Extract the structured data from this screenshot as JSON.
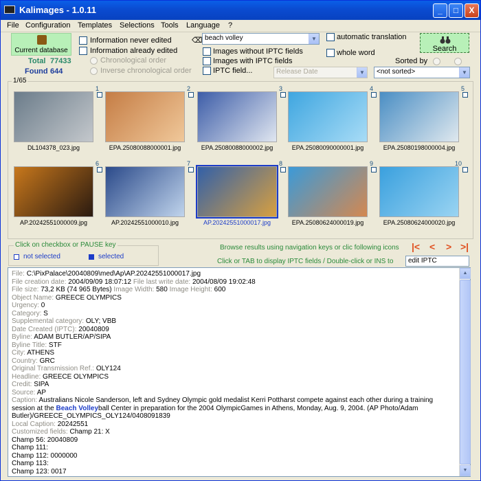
{
  "window": {
    "title": "Kalimages - 1.0.11",
    "minimize": "_",
    "maximize": "□",
    "close": "X"
  },
  "menu": [
    "File",
    "Configuration",
    "Templates",
    "Selections",
    "Tools",
    "Language",
    "?"
  ],
  "db": {
    "label": "Current database",
    "total_label": "Total",
    "total": "77433",
    "found_label": "Found",
    "found": "644"
  },
  "filters": {
    "never_edited": "Information never edited",
    "already_edited": "Information already edited",
    "chron": "Chronological order",
    "inv_chron": "Inverse chronological order",
    "query": "beach volley",
    "without_iptc": "Images without IPTC fields",
    "with_iptc": "Images with IPTC fields",
    "iptc_field": "IPTC field...",
    "release_date": "Release Date",
    "auto_translation": "automatic translation",
    "whole_word": "whole word",
    "sorted_by": "Sorted by",
    "not_sorted": "<not sorted>",
    "search": "Search"
  },
  "results": {
    "count": "1/65",
    "items": [
      {
        "num": "1",
        "file": "DL104378_023.jpg",
        "selected": false,
        "c1": "#6b7c8a",
        "c2": "#c4c8cc"
      },
      {
        "num": "2",
        "file": "EPA.25080088000001.jpg",
        "selected": false,
        "c1": "#c57d45",
        "c2": "#f0c89a"
      },
      {
        "num": "3",
        "file": "EPA.25080088000002.jpg",
        "selected": false,
        "c1": "#3d5da8",
        "c2": "#e0e6f0"
      },
      {
        "num": "4",
        "file": "EPA.25080090000001.jpg",
        "selected": false,
        "c1": "#3fa6e0",
        "c2": "#a8dcf6"
      },
      {
        "num": "5",
        "file": "EPA.25080198000004.jpg",
        "selected": false,
        "c1": "#4a8ec4",
        "c2": "#dfe8ee"
      },
      {
        "num": "6",
        "file": "AP.20242551000009.jpg",
        "selected": false,
        "c1": "#c8781c",
        "c2": "#2a1a10"
      },
      {
        "num": "7",
        "file": "AP.20242551000010.jpg",
        "selected": false,
        "c1": "#2b4a8a",
        "c2": "#c0d4ec"
      },
      {
        "num": "8",
        "file": "AP.20242551000017.jpg",
        "selected": true,
        "c1": "#3260a8",
        "c2": "#d8a040"
      },
      {
        "num": "9",
        "file": "EPA.25080624000019.jpg",
        "selected": false,
        "c1": "#3b9ad8",
        "c2": "#d48850"
      },
      {
        "num": "10",
        "file": "EPA.25080624000020.jpg",
        "selected": false,
        "c1": "#3aa0de",
        "c2": "#9ad4f2"
      }
    ]
  },
  "legend": {
    "title": "Click on checkbox or PAUSE key",
    "not_selected": "not selected",
    "selected": "selected"
  },
  "nav": {
    "browse": "Browse results using navigation keys or clic following icons",
    "display": "Click or TAB to display IPTC fields / Double-click or INS to",
    "edit": "edit IPTC",
    "first": "|<",
    "prev": "<",
    "next": ">",
    "last": ">|"
  },
  "detail": [
    {
      "l": "File:",
      "v": "C:\\PixPalace\\20040809\\med\\Ap\\AP.20242551000017.jpg"
    },
    {
      "l": "File creation date:",
      "v": "2004/09/09 18:07:12",
      "l2": "File last write date:",
      "v2": "2004/08/09 19:02:48"
    },
    {
      "l": "File size:",
      "v": "73,2 KB (74 965 Bytes)",
      "l2": "Image Width:",
      "v2": "580",
      "l3": "Image Height:",
      "v3": "600"
    },
    {
      "l": "Object Name:",
      "v": "GREECE OLYMPICS"
    },
    {
      "l": "Urgency:",
      "v": "0"
    },
    {
      "l": "Category:",
      "v": "S"
    },
    {
      "l": "Supplemental category:",
      "v": "OLY; VBB"
    },
    {
      "l": "Date Created (IPTC):",
      "v": "20040809"
    },
    {
      "l": "Byline:",
      "v": "ADAM BUTLER/AP/SIPA"
    },
    {
      "l": "Byline Title:",
      "v": "STF"
    },
    {
      "l": "City:",
      "v": "ATHENS"
    },
    {
      "l": "Country:",
      "v": "GRC"
    },
    {
      "l": "Original Transmission Ref.:",
      "v": "OLY124"
    },
    {
      "l": "Headline:",
      "v": "GREECE OLYMPICS"
    },
    {
      "l": "Credit:",
      "v": "SIPA"
    },
    {
      "l": "Source:",
      "v": "AP"
    },
    {
      "l": "Caption:",
      "v": "Australians Nicole Sanderson, left and Sydney Olympic gold medalist Kerri Pottharst compete against each other during a training"
    },
    {
      "l": "",
      "v": "session at the",
      "hl": "Beach Volley",
      "v2": "ball Center in preparation for the  2004 OlympicGames in Athens,  Monday, Aug. 9, 2004.  (AP Photo/Adam"
    },
    {
      "l": "",
      "v": "Butler)/GREECE_OLYMPICS_OLY124/0408091839"
    },
    {
      "l": "Local Caption:",
      "v": "20242551"
    },
    {
      "l": "Customized fields:",
      "v": "Champ 21: X"
    },
    {
      "l": "",
      "v": "Champ 56: 20040809"
    },
    {
      "l": "",
      "v": "Champ 111:"
    },
    {
      "l": "",
      "v": "Champ 112: 0000000"
    },
    {
      "l": "",
      "v": "Champ 113:"
    },
    {
      "l": "",
      "v": "Champ 123: 0017"
    }
  ]
}
